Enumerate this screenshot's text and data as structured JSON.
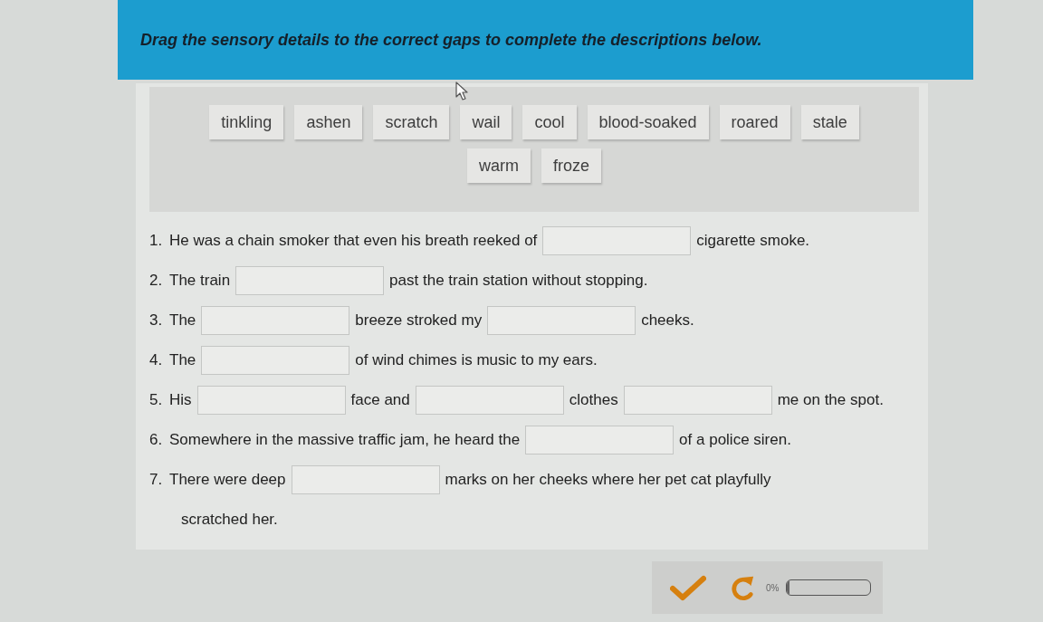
{
  "instructions": {
    "title": "Drag the sensory details to the correct gaps to complete the descriptions below."
  },
  "word_bank": [
    "tinkling",
    "ashen",
    "scratch",
    "wail",
    "cool",
    "blood-soaked",
    "roared",
    "stale",
    "warm",
    "froze"
  ],
  "sentences": [
    {
      "number": "1.",
      "lines": [
        [
          {
            "kind": "text",
            "text": "He was a chain smoker that even his breath reeked of"
          },
          {
            "kind": "gap"
          },
          {
            "kind": "text",
            "text": "cigarette smoke."
          }
        ]
      ]
    },
    {
      "number": "2.",
      "lines": [
        [
          {
            "kind": "text",
            "text": "The train"
          },
          {
            "kind": "gap"
          },
          {
            "kind": "text",
            "text": "past the train station without stopping."
          }
        ]
      ]
    },
    {
      "number": "3.",
      "lines": [
        [
          {
            "kind": "text",
            "text": "The"
          },
          {
            "kind": "gap"
          },
          {
            "kind": "text",
            "text": "breeze stroked my"
          },
          {
            "kind": "gap"
          },
          {
            "kind": "text",
            "text": "cheeks."
          }
        ]
      ]
    },
    {
      "number": "4.",
      "lines": [
        [
          {
            "kind": "text",
            "text": "The"
          },
          {
            "kind": "gap"
          },
          {
            "kind": "text",
            "text": "of wind chimes is music to my ears."
          }
        ]
      ]
    },
    {
      "number": "5.",
      "lines": [
        [
          {
            "kind": "text",
            "text": "His"
          },
          {
            "kind": "gap"
          },
          {
            "kind": "text",
            "text": "face and"
          },
          {
            "kind": "gap"
          },
          {
            "kind": "text",
            "text": "clothes"
          },
          {
            "kind": "gap"
          },
          {
            "kind": "text",
            "text": "me on the spot."
          }
        ]
      ]
    },
    {
      "number": "6.",
      "lines": [
        [
          {
            "kind": "text",
            "text": "Somewhere in the massive traffic jam, he heard the"
          },
          {
            "kind": "gap"
          },
          {
            "kind": "text",
            "text": "of a police siren."
          }
        ]
      ]
    },
    {
      "number": "7.",
      "lines": [
        [
          {
            "kind": "text",
            "text": "There were deep"
          },
          {
            "kind": "gap"
          },
          {
            "kind": "text",
            "text": "marks on her cheeks where her pet cat playfully"
          }
        ],
        [
          {
            "kind": "text",
            "text": "scratched her."
          }
        ]
      ]
    }
  ],
  "toolbar": {
    "progress": {
      "label": "0%",
      "level": 0
    }
  }
}
